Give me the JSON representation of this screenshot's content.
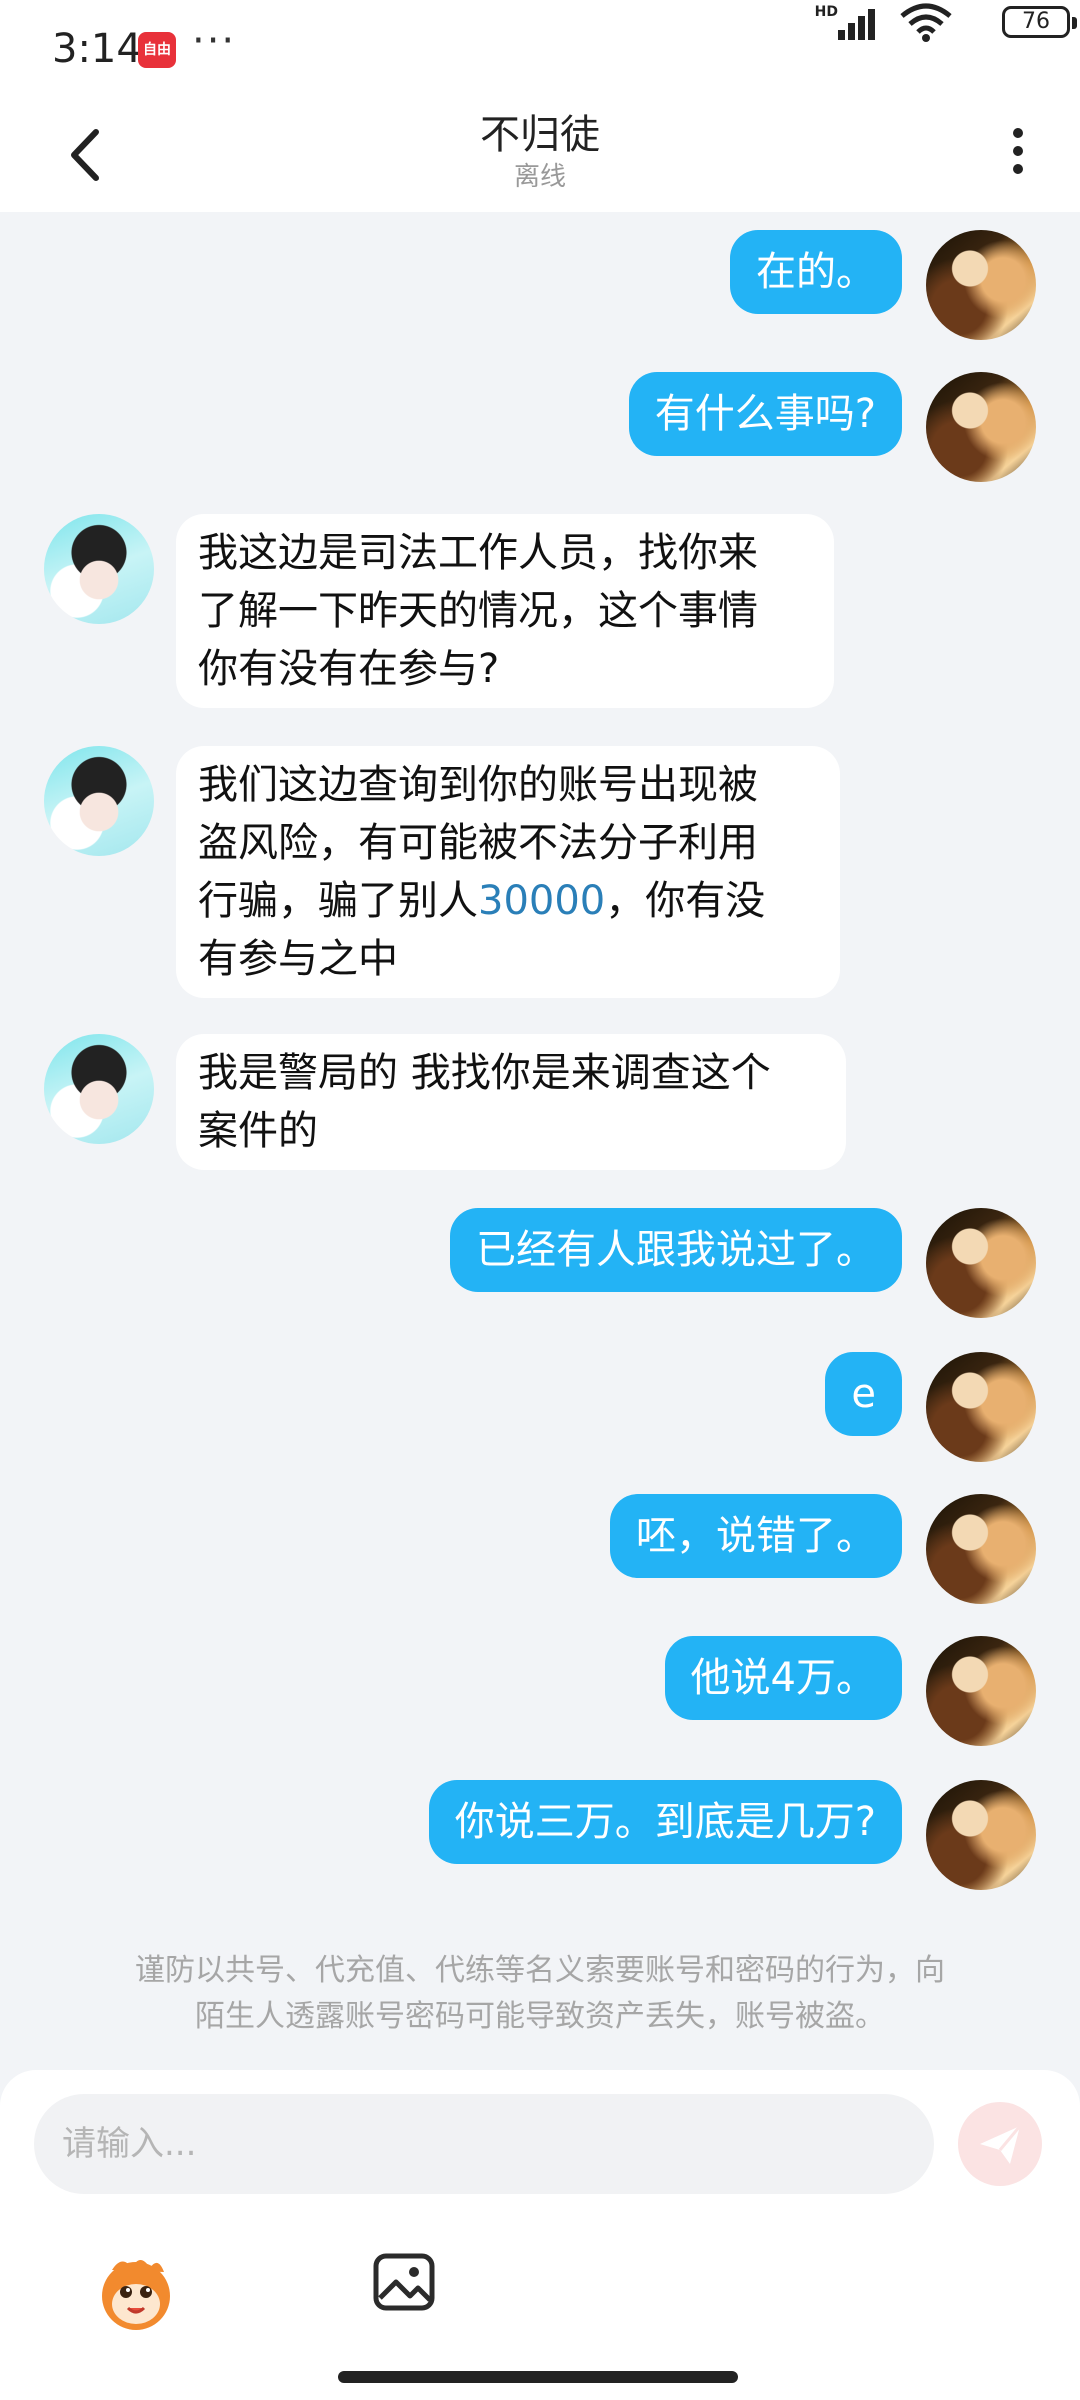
{
  "status_bar": {
    "time": "3:14",
    "app_badge": "自由",
    "dots": "···",
    "network": "HD",
    "battery": "76"
  },
  "header": {
    "title": "不归徒",
    "subtitle": "离线"
  },
  "messages": [
    {
      "side": "right",
      "text": "在的。"
    },
    {
      "side": "right",
      "text": "有什么事吗?"
    },
    {
      "side": "left",
      "lines": [
        "我这边是司法工作人员，找你来",
        "了解一下昨天的情况，这个事情",
        "你有没有在参与?"
      ]
    },
    {
      "side": "left",
      "lines_a": [
        "我们这边查询到你的账号出现被",
        "盗风险，有可能被不法分子利用"
      ],
      "line_c_pre": "行骗，骗了别人",
      "line_c_num": "30000",
      "line_c_post": "，你有没",
      "line_d": "有参与之中"
    },
    {
      "side": "left",
      "lines": [
        "我是警局的 我找你是来调查这个",
        "案件的"
      ]
    },
    {
      "side": "right",
      "text": "已经有人跟我说过了。"
    },
    {
      "side": "right",
      "text": "e"
    },
    {
      "side": "right",
      "text": "呸，说错了。"
    },
    {
      "side": "right",
      "text": "他说4万。"
    },
    {
      "side": "right",
      "text": "你说三万。到底是几万?"
    }
  ],
  "notice": {
    "line1": "谨防以共号、代充值、代练等名义索要账号和密码的行为，向",
    "line2": "陌生人透露账号密码可能导致资产丢失，账号被盗。"
  },
  "composer": {
    "placeholder": "请输入..."
  },
  "icons": {
    "back": "chevron-left-icon",
    "more": "more-vertical-icon",
    "send": "send-icon",
    "emoji": "emoji-face-icon",
    "image": "image-icon"
  },
  "colors": {
    "bubble_out": "#23b3f5",
    "bubble_in": "#ffffff",
    "background": "#f2f4f7",
    "link_number": "#2a7fb8"
  }
}
